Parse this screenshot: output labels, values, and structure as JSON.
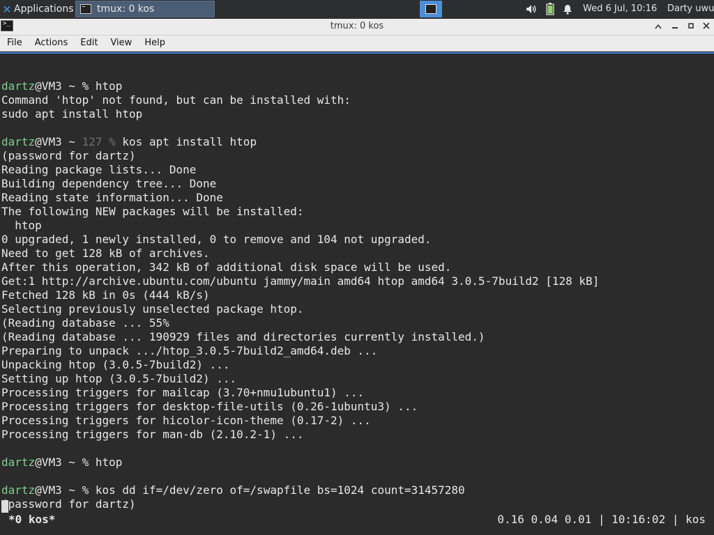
{
  "panel": {
    "applications_label": "Applications",
    "task_label": "tmux: 0 kos",
    "clock": "Wed  6 Jul, 10:16",
    "user": "Darty uwu",
    "icons": [
      "volume-icon",
      "battery-icon",
      "notification-bell-icon"
    ]
  },
  "window": {
    "title": "tmux: 0 kos"
  },
  "menu": [
    "File",
    "Actions",
    "Edit",
    "View",
    "Help"
  ],
  "terminal": {
    "lines": [
      [],
      [
        {
          "t": "dartz",
          "c": "pu"
        },
        {
          "t": "@VM3 ~ % htop"
        }
      ],
      [
        {
          "t": "Command 'htop' not found, but can be installed with:"
        }
      ],
      [
        {
          "t": "sudo apt install htop"
        }
      ],
      [],
      [
        {
          "t": "dartz",
          "c": "pu"
        },
        {
          "t": "@VM3 ~ "
        },
        {
          "t": "127 %",
          "c": "dim"
        },
        {
          "t": " kos apt install htop"
        }
      ],
      [
        {
          "t": "(password for dartz)"
        }
      ],
      [
        {
          "t": "Reading package lists... Done"
        }
      ],
      [
        {
          "t": "Building dependency tree... Done"
        }
      ],
      [
        {
          "t": "Reading state information... Done"
        }
      ],
      [
        {
          "t": "The following NEW packages will be installed:"
        }
      ],
      [
        {
          "t": "  htop"
        }
      ],
      [
        {
          "t": "0 upgraded, 1 newly installed, 0 to remove and 104 not upgraded."
        }
      ],
      [
        {
          "t": "Need to get 128 kB of archives."
        }
      ],
      [
        {
          "t": "After this operation, 342 kB of additional disk space will be used."
        }
      ],
      [
        {
          "t": "Get:1 http://archive.ubuntu.com/ubuntu jammy/main amd64 htop amd64 3.0.5-7build2 [128 kB]"
        }
      ],
      [
        {
          "t": "Fetched 128 kB in 0s (444 kB/s)"
        }
      ],
      [
        {
          "t": "Selecting previously unselected package htop."
        }
      ],
      [
        {
          "t": "(Reading database ... 55%"
        }
      ],
      [
        {
          "t": "(Reading database ... 190929 files and directories currently installed.)"
        }
      ],
      [
        {
          "t": "Preparing to unpack .../htop_3.0.5-7build2_amd64.deb ..."
        }
      ],
      [
        {
          "t": "Unpacking htop (3.0.5-7build2) ..."
        }
      ],
      [
        {
          "t": "Setting up htop (3.0.5-7build2) ..."
        }
      ],
      [
        {
          "t": "Processing triggers for mailcap (3.70+nmu1ubuntu1) ..."
        }
      ],
      [
        {
          "t": "Processing triggers for desktop-file-utils (0.26-1ubuntu3) ..."
        }
      ],
      [
        {
          "t": "Processing triggers for hicolor-icon-theme (0.17-2) ..."
        }
      ],
      [
        {
          "t": "Processing triggers for man-db (2.10.2-1) ..."
        }
      ],
      [],
      [
        {
          "t": "dartz",
          "c": "pu"
        },
        {
          "t": "@VM3 ~ % htop"
        }
      ],
      [],
      [
        {
          "t": "dartz",
          "c": "pu"
        },
        {
          "t": "@VM3 ~ % kos dd if=/dev/zero of=/swapfile bs=1024 count=31457280"
        }
      ],
      [
        {
          "t": "(password for dartz)"
        }
      ]
    ],
    "status_left": "*0 kos*",
    "status_right": "0.16 0.04 0.01 | 10:16:02 | kos",
    "colors": {
      "background": "#2b2b2b",
      "text": "#e8e8e8",
      "user": "#7fcf8e",
      "dim": "#6f6f6f",
      "accent": "#3f7fd8"
    }
  }
}
